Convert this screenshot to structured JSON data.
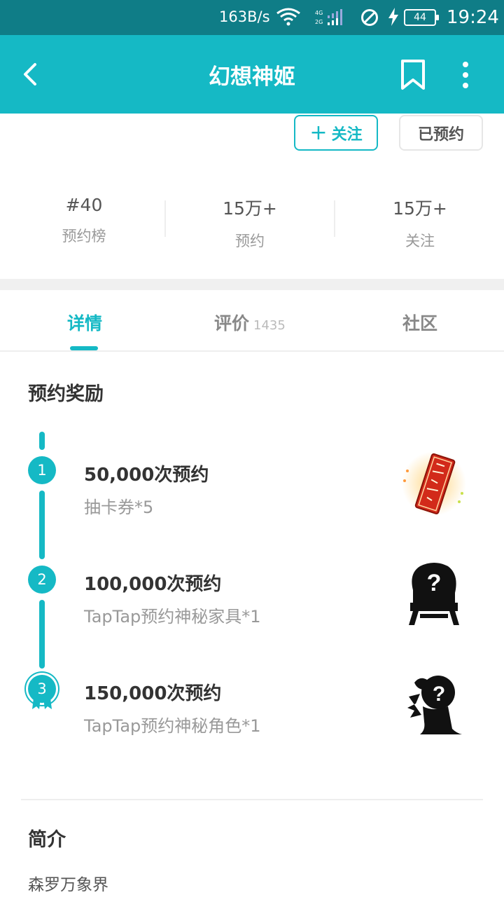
{
  "status_bar": {
    "speed": "163B/s",
    "signal_top": "4G",
    "signal_bottom": "2G",
    "battery": "44",
    "time": "19:24"
  },
  "app_bar": {
    "title": "幻想神姬",
    "icons": [
      "back-arrow-icon",
      "bookmark-icon",
      "more-vertical-icon"
    ]
  },
  "actions": {
    "follow_label": "关注",
    "reserved_label": "已预约"
  },
  "stats": [
    {
      "value": "#40",
      "label": "预约榜"
    },
    {
      "value": "15万+",
      "label": "预约"
    },
    {
      "value": "15万+",
      "label": "关注"
    }
  ],
  "tabs": [
    {
      "label": "详情",
      "count": ""
    },
    {
      "label": "评价",
      "count": "1435"
    },
    {
      "label": "社区",
      "count": ""
    }
  ],
  "rewards": {
    "title": "预约奖励",
    "items": [
      {
        "step": "1",
        "title": "50,000次预约",
        "desc": "抽卡券*5"
      },
      {
        "step": "2",
        "title": "100,000次预约",
        "desc": "TapTap预约神秘家具*1"
      },
      {
        "step": "3",
        "title": "150,000次预约",
        "desc": "TapTap预约神秘角色*1"
      }
    ]
  },
  "intro": {
    "title": "简介",
    "text": "森罗万象界"
  },
  "colors": {
    "accent": "#15b9c5",
    "status_bar": "#0f7d87"
  }
}
